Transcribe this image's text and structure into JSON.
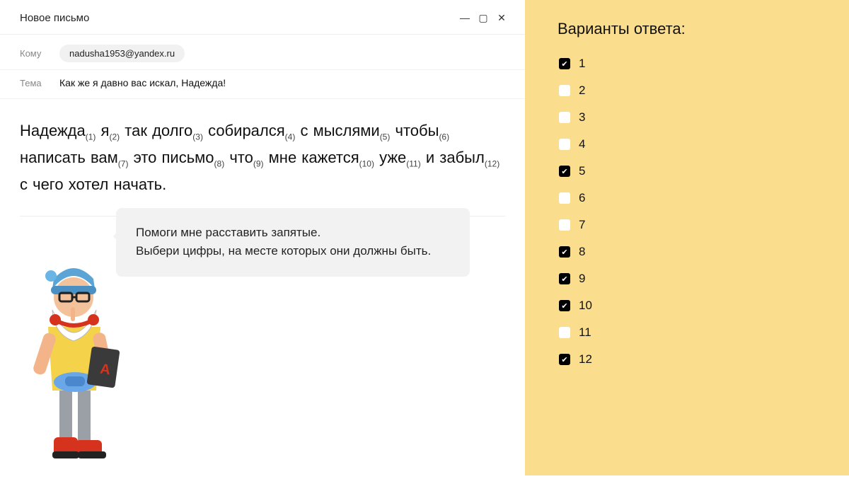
{
  "window": {
    "title": "Новое письмо"
  },
  "fields": {
    "to_label": "Кому",
    "to_value": "nadusha1953@yandex.ru",
    "subject_label": "Тема",
    "subject_value": "Как же я давно вас искал, Надежда!"
  },
  "body": {
    "w1": "Надежда",
    "n1": "(1)",
    "w2": "я",
    "n2": "(2)",
    "w3": "так долго",
    "n3": "(3)",
    "w4": "собирался",
    "n4": "(4)",
    "w5": "с мыслями",
    "n5": "(5)",
    "w6": "чтобы",
    "n6": "(6)",
    "w7": "написать вам",
    "n7": "(7)",
    "w8": "это письмо",
    "n8": "(8)",
    "w9": "что",
    "n9": "(9)",
    "w10": "мне кажется",
    "n10": "(10)",
    "w11": "уже",
    "n11": "(11)",
    "w12": "и забыл",
    "n12": "(12)",
    "tail": "с чего хотел начать."
  },
  "speech": {
    "line1": "Помоги мне расставить запятые.",
    "line2": "Выбери цифры, на месте которых они должны быть."
  },
  "answers": {
    "title": "Варианты ответа:",
    "options": [
      {
        "label": "1",
        "checked": true
      },
      {
        "label": "2",
        "checked": false
      },
      {
        "label": "3",
        "checked": false
      },
      {
        "label": "4",
        "checked": false
      },
      {
        "label": "5",
        "checked": true
      },
      {
        "label": "6",
        "checked": false
      },
      {
        "label": "7",
        "checked": false
      },
      {
        "label": "8",
        "checked": true
      },
      {
        "label": "9",
        "checked": true
      },
      {
        "label": "10",
        "checked": true
      },
      {
        "label": "11",
        "checked": false
      },
      {
        "label": "12",
        "checked": true
      }
    ]
  }
}
